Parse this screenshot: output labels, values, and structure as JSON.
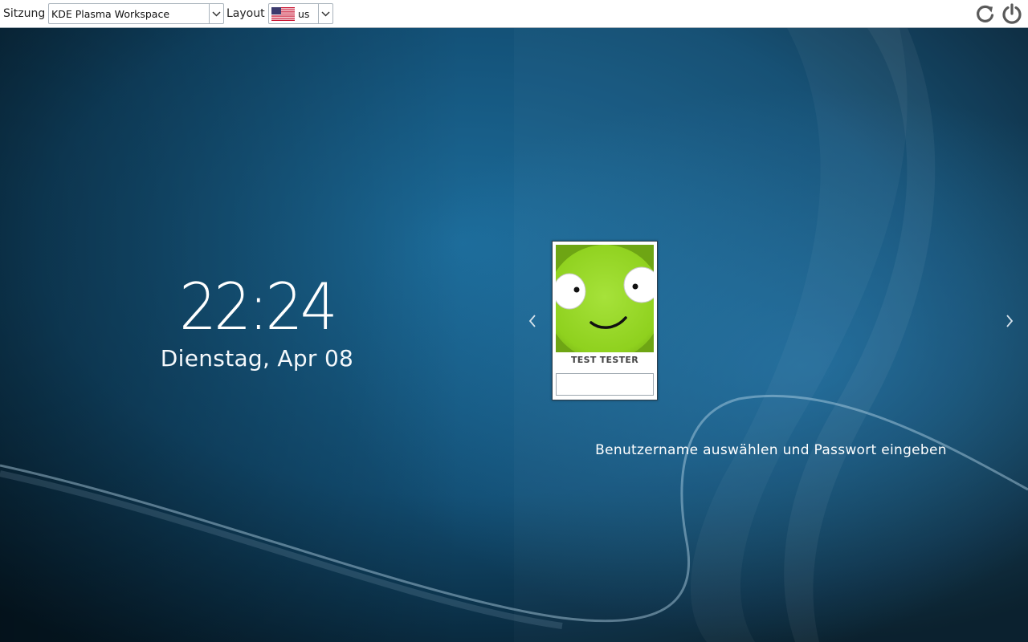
{
  "topbar": {
    "session_label": "Sitzung",
    "session_value": "KDE Plasma Workspace",
    "layout_label": "Layout",
    "layout_value": "us"
  },
  "clock": {
    "time": "22:24",
    "date": "Dienstag, Apr 08"
  },
  "user": {
    "name": "TEST TESTER",
    "password_value": ""
  },
  "hint": "Benutzername auswählen und Passwort eingeben",
  "icons": {
    "reboot": "reboot-icon",
    "power": "power-icon",
    "prev": "chevron-left-icon",
    "next": "chevron-right-icon",
    "flag": "us-flag-icon"
  },
  "colors": {
    "background_dark": "#06202f",
    "background_mid": "#17628e",
    "avatar_green": "#8fd11e",
    "text": "#ffffff"
  }
}
